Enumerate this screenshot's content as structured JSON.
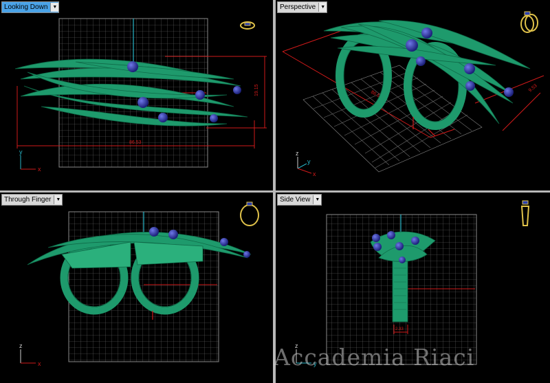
{
  "viewports": {
    "top_left": {
      "title": "Looking Down",
      "active": true,
      "axes": [
        "y",
        "x"
      ],
      "dim_horizontal": "86.53",
      "dim_vertical": "19.15"
    },
    "top_right": {
      "title": "Perspective",
      "active": false,
      "axes": [
        "z",
        "y",
        "x"
      ],
      "dim_a": "86.53",
      "dim_b": "9.53"
    },
    "bottom_left": {
      "title": "Through Finger",
      "active": false,
      "axes": [
        "z",
        "x"
      ]
    },
    "bottom_right": {
      "title": "Side View",
      "active": false,
      "axes": [
        "z",
        "y"
      ],
      "dim_small": "2.33"
    }
  },
  "watermark": "Accademia Riaci",
  "colors": {
    "ring": "#1e9a6c",
    "ring_dark": "#0f6a48",
    "gem": "#2a2f9a",
    "grid": "#7a7a7a",
    "dimension": "#d11a1a",
    "axis_cyan": "#27b6c8",
    "icon_gold": "#e0c24a"
  },
  "dropdown_icon": "chevron-down-icon"
}
